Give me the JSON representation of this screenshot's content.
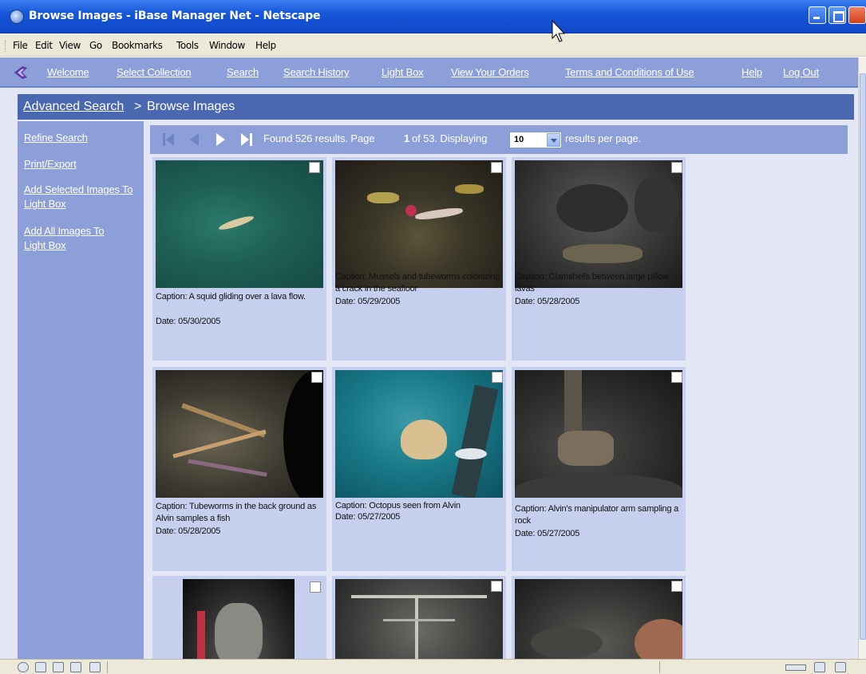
{
  "window": {
    "title": "Browse Images - iBase Manager Net - Netscape"
  },
  "menubar": {
    "items": [
      "File",
      "Edit",
      "View",
      "Go",
      "Bookmarks",
      "Tools",
      "Window",
      "Help"
    ]
  },
  "sitenav": {
    "items": [
      "Welcome",
      "Select Collection",
      "Search",
      "Search History",
      "Light Box",
      "View Your Orders",
      "Terms and Conditions of Use",
      "Help",
      "Log Out"
    ]
  },
  "breadcrumb": {
    "link": "Advanced Search",
    "separator": ">",
    "current": "Browse Images"
  },
  "sidebar": {
    "links": [
      "Refine Search",
      "Print/Export",
      "Add Selected Images To Light Box",
      "Add All Images To Light Box"
    ]
  },
  "pager": {
    "text_prefix": "Found 526 results. Page",
    "page": "1",
    "text_middle": "of 53. Displaying",
    "per_page": "10",
    "text_suffix": "results per page."
  },
  "images": [
    {
      "caption": "Caption:  A squid gliding over a lava flow.",
      "date": "Date:  05/30/2005"
    },
    {
      "caption": "Caption:  Mussels and tubeworms colonizing a crack in the seafloor",
      "date": "Date:  05/29/2005"
    },
    {
      "caption": "Caption:  Clamshells between large pillow lavas",
      "date": "Date:  05/28/2005"
    },
    {
      "caption": "Caption:  Tubeworms in the back ground as Alvin samples a fish",
      "date": "Date:  05/28/2005"
    },
    {
      "caption": "Caption:  Octopus seen from Alvin",
      "date": "Date:  05/27/2005"
    },
    {
      "caption": "Caption:  Alvin's manipulator arm sampling a rock",
      "date": "Date:  05/27/2005"
    }
  ],
  "colors": {
    "titlebar": "#1656d8",
    "nav": "#8d9fd8",
    "breadcrumb": "#4a68b0",
    "card": "#c7cfee"
  }
}
